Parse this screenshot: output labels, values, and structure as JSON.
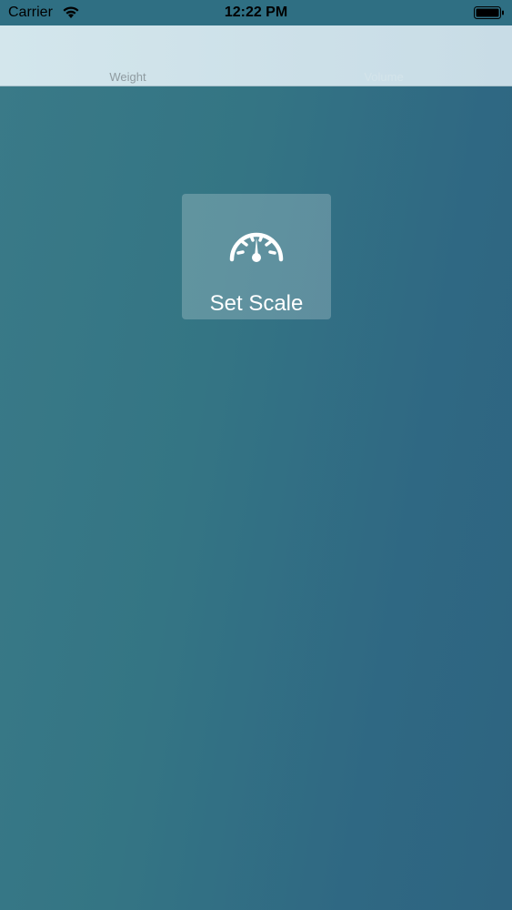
{
  "status_bar": {
    "carrier": "Carrier",
    "time": "12:22 PM",
    "icons": [
      "wifi-icon",
      "battery-icon"
    ]
  },
  "tabs": [
    {
      "label": "Weight"
    },
    {
      "label": "Volume"
    }
  ],
  "main": {
    "set_scale_label": "Set Scale",
    "icon": "gauge-icon"
  },
  "colors": {
    "background_start": "#3a7a88",
    "background_end": "#2e6480",
    "header_bg": "#d3e6ec",
    "button_bg": "rgba(255,255,255,0.22)",
    "button_text": "#ffffff"
  }
}
